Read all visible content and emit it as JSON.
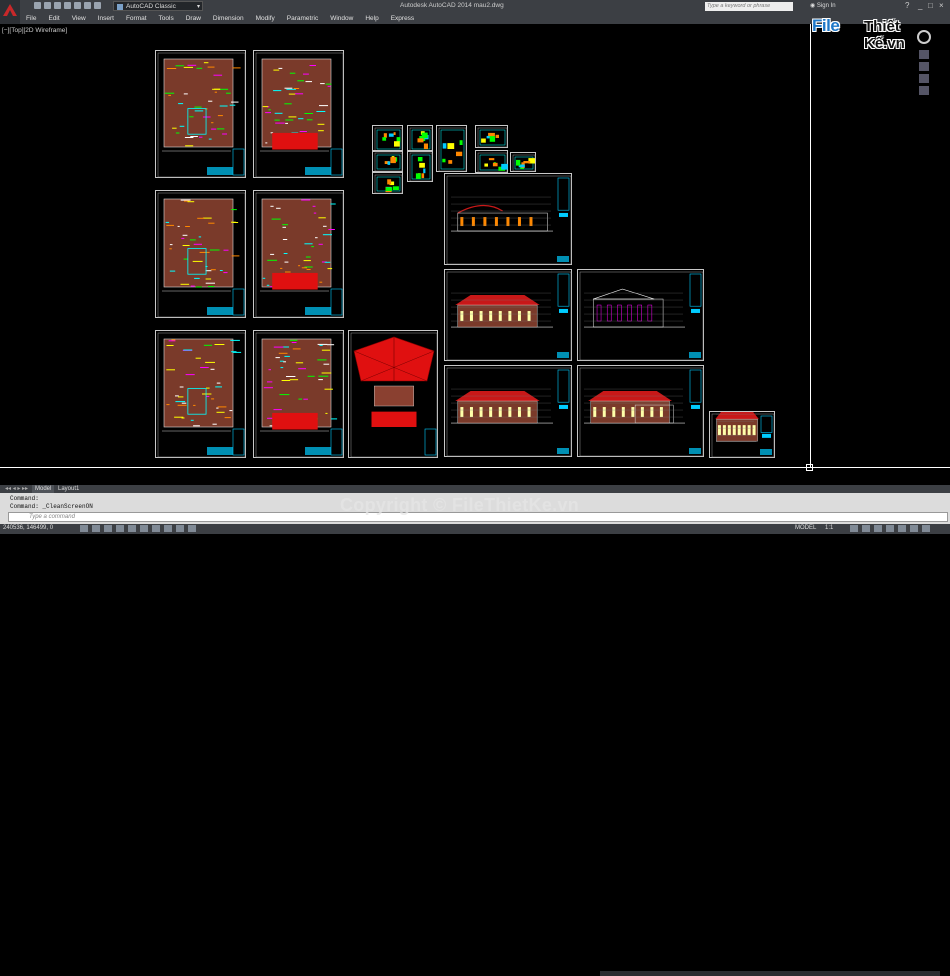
{
  "app": {
    "title": "Autodesk AutoCAD 2014   mau2.dwg",
    "workspace": "AutoCAD Classic",
    "search_placeholder": "Type a keyword or phrase",
    "signin_label": "Sign In",
    "minimize": "_",
    "maximize": "□",
    "close": "×"
  },
  "menu": [
    "File",
    "Edit",
    "View",
    "Insert",
    "Format",
    "Tools",
    "Draw",
    "Dimension",
    "Modify",
    "Parametric",
    "Window",
    "Help",
    "Express"
  ],
  "viewport_label": "[−][Top][2D Wireframe]",
  "brand": {
    "part1": "File",
    "part2": "Thiết Kế.vn"
  },
  "tabs": {
    "model": "Model",
    "layout": "Layout1"
  },
  "command": {
    "line1": "Command:",
    "line2": "Command:  _CleanScreenON",
    "placeholder": "Type a command"
  },
  "status": {
    "coords": "240536, 146499, 0",
    "model": "MODEL",
    "scale": "1:1"
  },
  "watermark": "Copyright © FileThietKe.vn"
}
